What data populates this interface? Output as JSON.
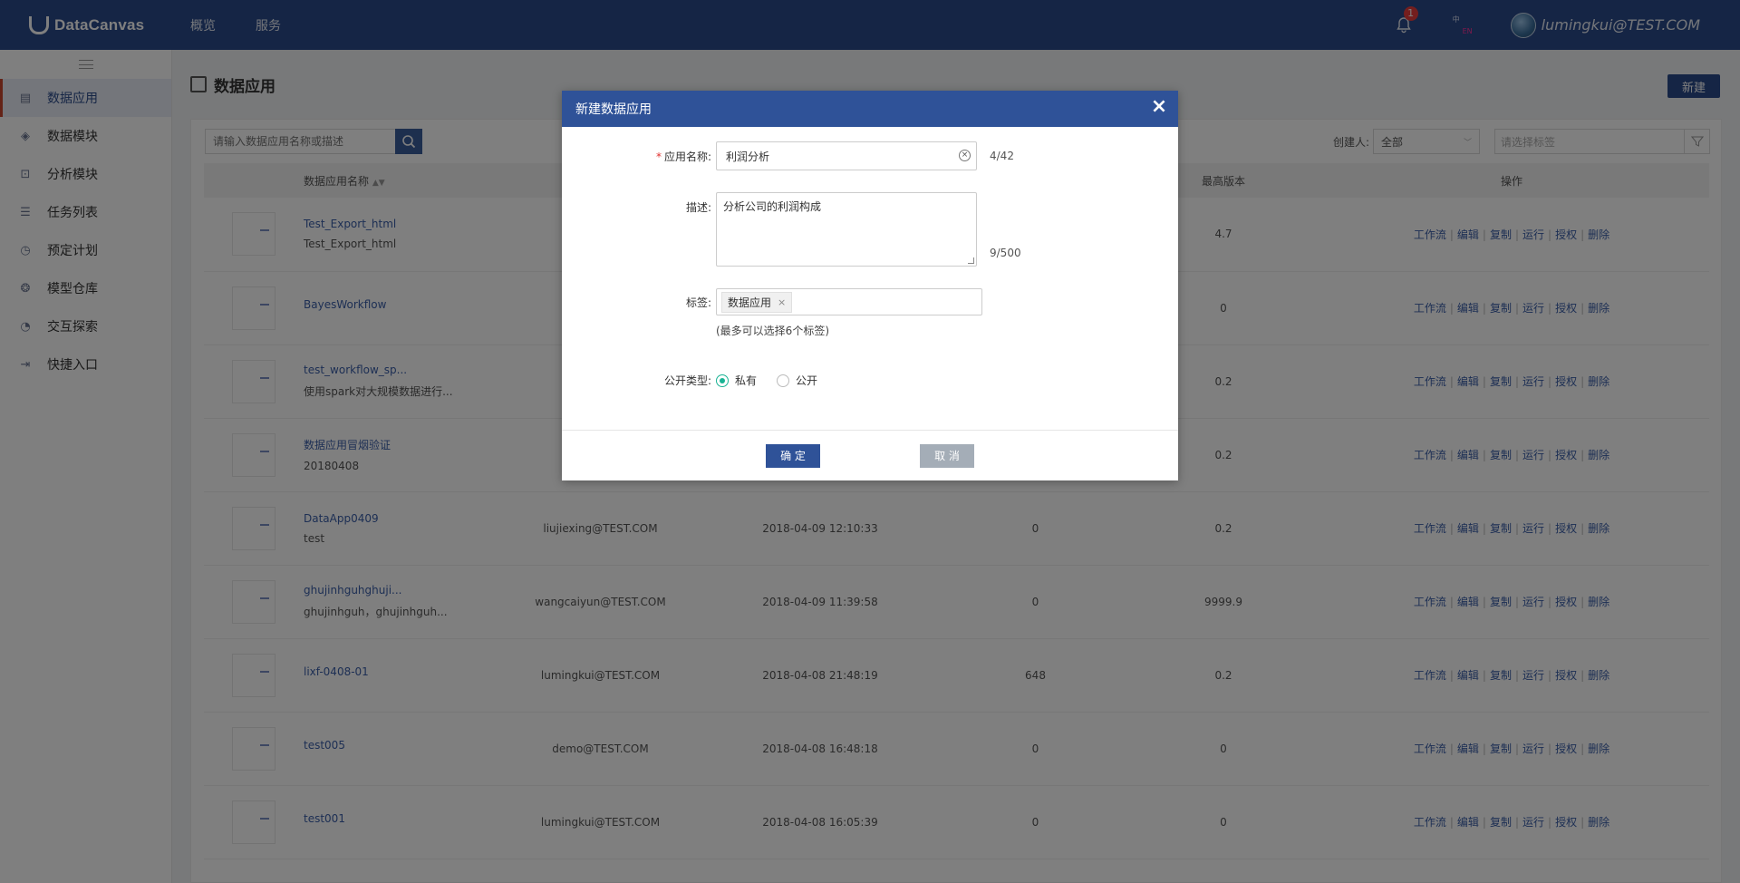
{
  "app": {
    "logo_text": "DataCanvas"
  },
  "topnav": [
    {
      "label": "概览"
    },
    {
      "label": "服务"
    }
  ],
  "header": {
    "notification_count": "1",
    "lang_zh": "中",
    "lang_en": "EN",
    "user": "lumingkui@TEST.COM"
  },
  "sidebar": {
    "items": [
      {
        "label": "数据应用",
        "icon": "data-app-icon",
        "active": true
      },
      {
        "label": "数据模块",
        "icon": "layers-icon"
      },
      {
        "label": "分析模块",
        "icon": "analysis-icon"
      },
      {
        "label": "任务列表",
        "icon": "task-list-icon"
      },
      {
        "label": "预定计划",
        "icon": "schedule-icon"
      },
      {
        "label": "模型仓库",
        "icon": "model-repo-icon"
      },
      {
        "label": "交互探索",
        "icon": "explore-icon"
      },
      {
        "label": "快捷入口",
        "icon": "shortcut-icon"
      }
    ]
  },
  "page": {
    "title": "数据应用",
    "new_button": "新建",
    "search_placeholder": "请输入数据应用名称或描述",
    "creator_label": "创建人:",
    "creator_value": "全部",
    "tag_placeholder": "请选择标签"
  },
  "table": {
    "headers": {
      "name": "数据应用名称",
      "creator": "",
      "time": "",
      "count": "",
      "version": "最高版本",
      "ops": "操作"
    },
    "ops": [
      "工作流",
      "编辑",
      "复制",
      "运行",
      "授权",
      "删除"
    ],
    "rows": [
      {
        "name": "Test_Export_html",
        "desc": "Test_Export_html",
        "creator": "",
        "time": "",
        "count": "",
        "version": "4.7"
      },
      {
        "name": "BayesWorkflow",
        "desc": "",
        "creator": "",
        "time": "",
        "count": "",
        "version": "0"
      },
      {
        "name": "test_workflow_sp...",
        "desc": "使用spark对大规模数据进行...",
        "creator": "",
        "time": "",
        "count": "",
        "version": "0.2"
      },
      {
        "name": "数据应用冒烟验证",
        "desc": "20180408",
        "creator": "",
        "time": "",
        "count": "",
        "version": "0.2"
      },
      {
        "name": "DataApp0409",
        "desc": "test",
        "creator": "liujiexing@TEST.COM",
        "time": "2018-04-09 12:10:33",
        "count": "0",
        "version": "0.2"
      },
      {
        "name": "ghujinhguhghuji...",
        "desc": "ghujinhguh，ghujinhguh...",
        "creator": "wangcaiyun@TEST.COM",
        "time": "2018-04-09 11:39:58",
        "count": "0",
        "version": "9999.9"
      },
      {
        "name": "lixf-0408-01",
        "desc": "",
        "creator": "lumingkui@TEST.COM",
        "time": "2018-04-08 21:48:19",
        "count": "648",
        "version": "0.2"
      },
      {
        "name": "test005",
        "desc": "",
        "creator": "demo@TEST.COM",
        "time": "2018-04-08 16:48:18",
        "count": "0",
        "version": "0"
      },
      {
        "name": "test001",
        "desc": "",
        "creator": "lumingkui@TEST.COM",
        "time": "2018-04-08 16:05:39",
        "count": "0",
        "version": "0"
      }
    ]
  },
  "modal": {
    "title": "新建数据应用",
    "name_label": "应用名称:",
    "name_value": "利润分析",
    "name_counter": "4/42",
    "desc_label": "描述:",
    "desc_value": "分析公司的利润构成",
    "desc_counter": "9/500",
    "tag_label": "标签:",
    "tag_value": "数据应用",
    "tag_hint": "(最多可以选择6个标签)",
    "visibility_label": "公开类型:",
    "visibility_options": [
      {
        "label": "私有",
        "checked": true
      },
      {
        "label": "公开",
        "checked": false
      }
    ],
    "ok_label": "确 定",
    "cancel_label": "取 消"
  }
}
